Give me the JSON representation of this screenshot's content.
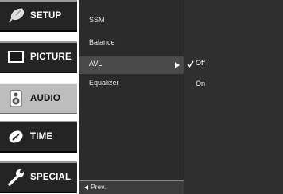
{
  "sidebar": {
    "items": [
      {
        "label": "SETUP",
        "icon": "satellite-dish-icon",
        "active": false
      },
      {
        "label": "PICTURE",
        "icon": "tv-screen-icon",
        "active": false
      },
      {
        "label": "AUDIO",
        "icon": "speaker-icon",
        "active": true
      },
      {
        "label": "TIME",
        "icon": "clock-icon",
        "active": false
      },
      {
        "label": "SPECIAL",
        "icon": "wrench-icon",
        "active": false
      }
    ]
  },
  "submenu": {
    "items": [
      {
        "label": "SSM"
      },
      {
        "label": "Balance"
      },
      {
        "label": "AVL",
        "selected": true
      },
      {
        "label": "Equalizer"
      }
    ],
    "footer_label": "Prev."
  },
  "options": {
    "items": [
      {
        "label": "Off",
        "checked": true
      },
      {
        "label": "On",
        "checked": false
      }
    ]
  },
  "colors": {
    "nav_background": "#242424",
    "nav_active": "#bdbdbd",
    "submenu_background": "#2b2b2b",
    "submenu_selected": "#4a4a4a",
    "options_background": "#2f2f2f",
    "text": "#ffffff"
  }
}
